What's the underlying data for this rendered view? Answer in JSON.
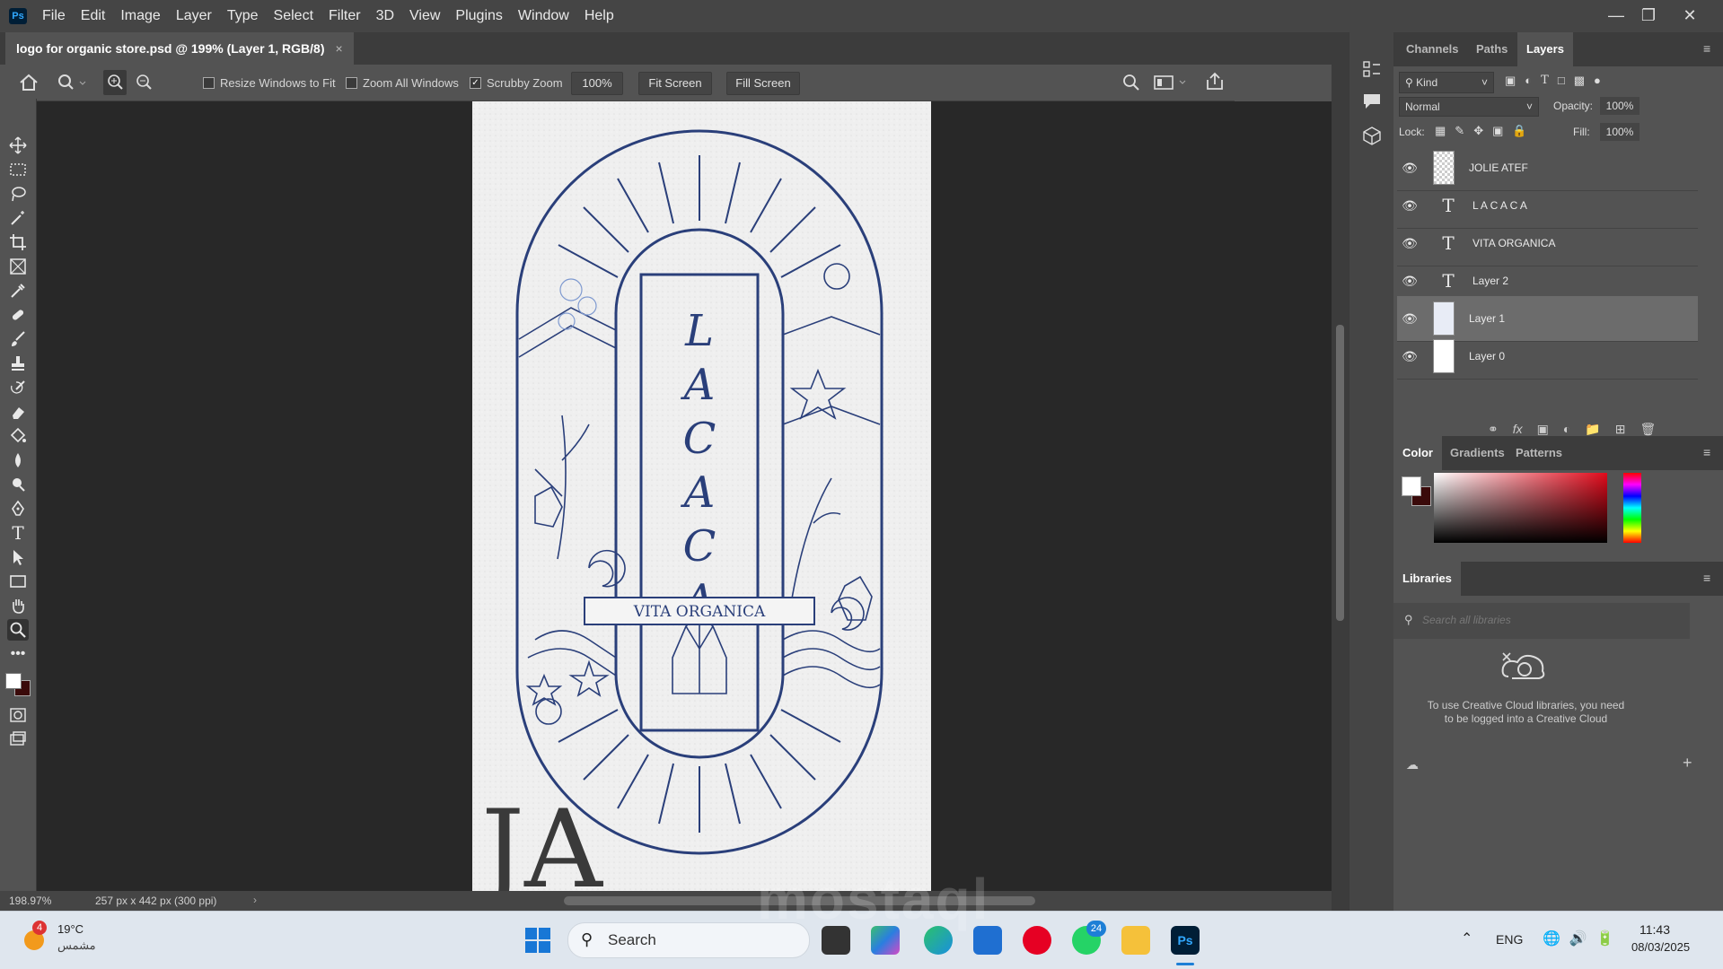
{
  "app": {
    "menu": [
      "File",
      "Edit",
      "Image",
      "Layer",
      "Type",
      "Select",
      "Filter",
      "3D",
      "View",
      "Plugins",
      "Window",
      "Help"
    ],
    "logo_text": "Ps"
  },
  "document_tab": {
    "title": "logo for organic store.psd @ 199% (Layer 1, RGB/8)",
    "close": "×"
  },
  "options_bar": {
    "resize_windows": "Resize Windows to Fit",
    "zoom_all": "Zoom All Windows",
    "scrubby_zoom": "Scrubby Zoom",
    "zoom_value": "100%",
    "fit_screen": "Fit Screen",
    "fill_screen": "Fill Screen"
  },
  "canvas_art": {
    "title_letters": [
      "L",
      "A",
      "C",
      "A",
      "C",
      "A"
    ],
    "banner": "VITA ORGANICA",
    "signature": "JA"
  },
  "status": {
    "zoom": "198.97%",
    "doc_size": "257 px x 442 px (300 ppi)"
  },
  "layers_panel": {
    "tabs": [
      "Channels",
      "Paths",
      "Layers"
    ],
    "kind": "Kind",
    "blend_mode": "Normal",
    "opacity_label": "Opacity:",
    "opacity": "100%",
    "lock_label": "Lock:",
    "fill_label": "Fill:",
    "fill": "100%",
    "layers": [
      {
        "name": "JOLIE ATEF",
        "type": "image"
      },
      {
        "name": "L A C A C A",
        "type": "text"
      },
      {
        "name": "VITA ORGANICA",
        "type": "text"
      },
      {
        "name": "Layer 2",
        "type": "text"
      },
      {
        "name": "Layer 1",
        "type": "image"
      },
      {
        "name": "Layer 0",
        "type": "image"
      }
    ]
  },
  "color_panel": {
    "tabs": [
      "Color",
      "Gradients",
      "Patterns"
    ],
    "fg": "#ffffff",
    "bg": "#3a0a0a"
  },
  "libraries_panel": {
    "title": "Libraries",
    "search_placeholder": "Search all libraries",
    "message": "To use Creative Cloud libraries, you need to be logged into a Creative Cloud"
  },
  "taskbar": {
    "weather_temp": "19°C",
    "weather_desc": "مشمس",
    "weather_badge": "4",
    "search": "Search",
    "whatsapp_badge": "24",
    "lang": "ENG",
    "time": "11:43",
    "date": "08/03/2025"
  },
  "watermark": "mostaql"
}
